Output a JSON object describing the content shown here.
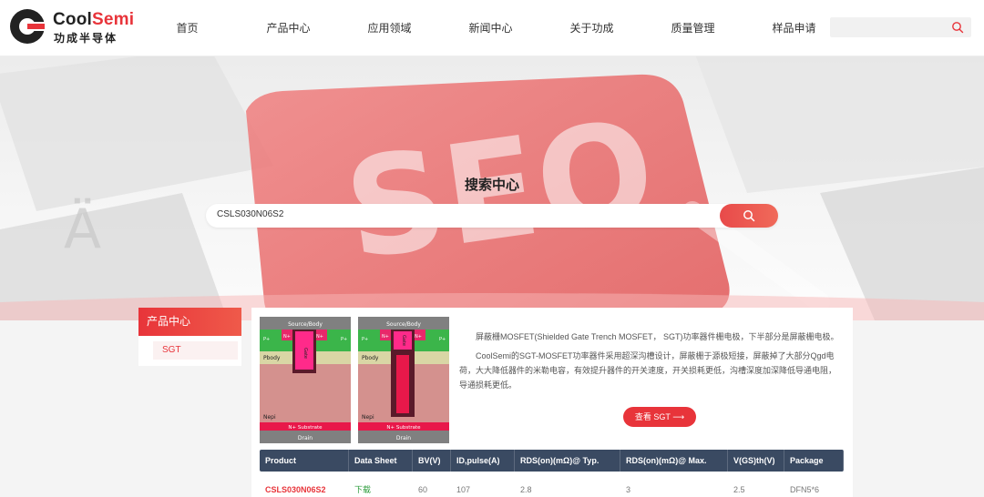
{
  "brand": {
    "name_part1": "Cool",
    "name_part2": "Semi",
    "name_cn": "功成半导体",
    "accent": "#e8343a"
  },
  "nav": {
    "items": [
      "首页",
      "产品中心",
      "应用领域",
      "新闻中心",
      "关于功成",
      "质量管理",
      "样品申请"
    ]
  },
  "search_top": {
    "placeholder": ""
  },
  "banner": {
    "title": "搜索中心",
    "search_value": "CSLS030N06S2"
  },
  "sidebar": {
    "heading": "产品中心",
    "items": [
      "SGT"
    ]
  },
  "diagram": {
    "top_label": "Source/Body",
    "gate_label": "Gate",
    "n_plus": "N+",
    "p_plus": "P+",
    "pbody": "Pbody",
    "nepi": "Nepi",
    "substrate": "N+ Substrate",
    "drain": "Drain"
  },
  "product": {
    "desc1": "屏蔽栅MOSFET(Shielded Gate Trench MOSFET， SGT)功率器件栅电极，下半部分是屏蔽栅电极。",
    "desc2": "CoolSemi的SGT-MOSFET功率器件采用超深沟槽设计，屏蔽栅于源极短接，屏蔽掉了大部分Qgd电荷，大大降低器件的米勒电容，有效提升器件的开关速度，开关损耗更低，沟槽深度加深降低导通电阻，导通损耗更低。",
    "view_button": "查看 SGT ⟶"
  },
  "table": {
    "headers": [
      "Product",
      "Data Sheet",
      "BV(V)",
      "ID,pulse(A)",
      "RDS(on)(mΩ)@ Typ.",
      "RDS(on)(mΩ)@ Max.",
      "V(GS)th(V)",
      "Package"
    ],
    "rows": [
      [
        "CSLS030N06S2",
        "下载",
        "60",
        "107",
        "2.8",
        "3",
        "2.5",
        "DFN5*6"
      ]
    ]
  }
}
